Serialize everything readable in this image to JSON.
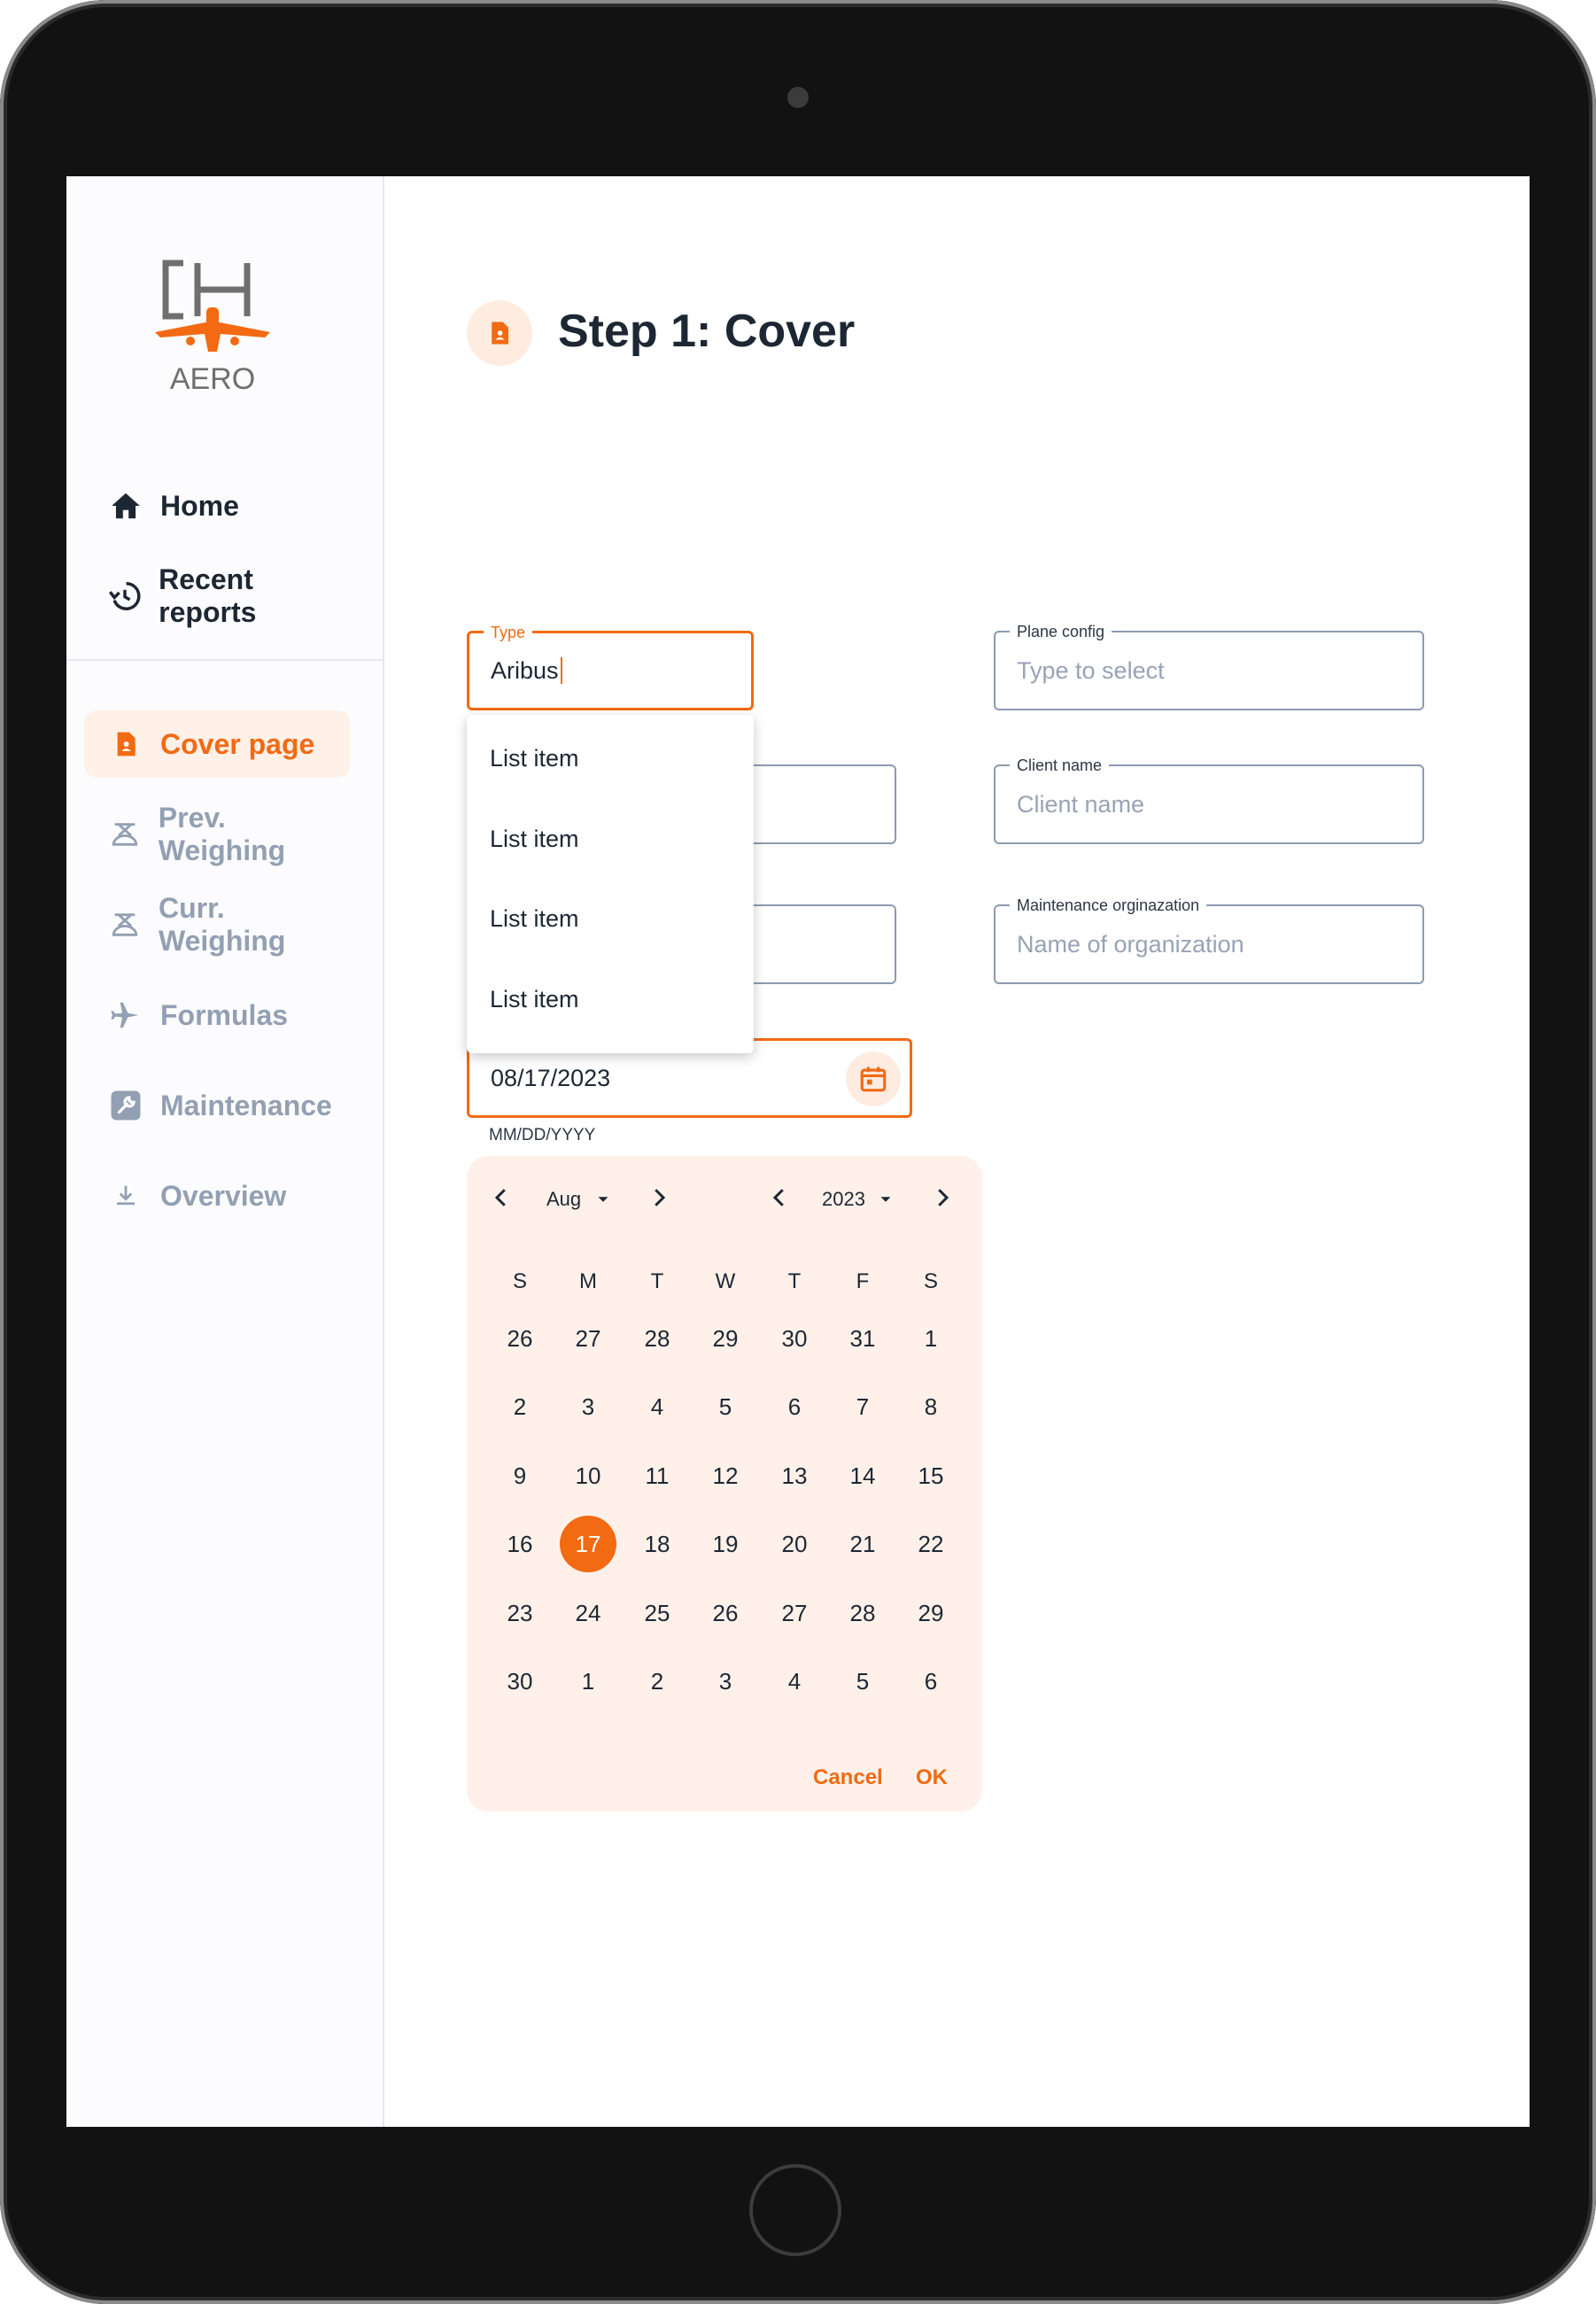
{
  "app": {
    "logo_text": "AERO"
  },
  "sidebar": {
    "primary": [
      {
        "label": "Home",
        "icon": "home-icon"
      },
      {
        "label": "Recent reports",
        "icon": "history-icon"
      }
    ],
    "steps": [
      {
        "label": "Cover page",
        "icon": "document-icon",
        "active": true
      },
      {
        "label": "Prev. Weighing",
        "icon": "scale-icon"
      },
      {
        "label": "Curr. Weighing",
        "icon": "scale-icon"
      },
      {
        "label": "Formulas",
        "icon": "airplane-icon"
      },
      {
        "label": "Maintenance",
        "icon": "wrench-icon"
      },
      {
        "label": "Overview",
        "icon": "download-icon"
      }
    ]
  },
  "page": {
    "title": "Step 1: Cover"
  },
  "form": {
    "type": {
      "label": "Type",
      "value": "Aribus"
    },
    "plane_config": {
      "label": "Plane config",
      "placeholder": "Type to select"
    },
    "client_name": {
      "label": "Client name",
      "placeholder": "Client name"
    },
    "maintenance_org": {
      "label": "Maintenance orginazation",
      "placeholder": "Name of organization"
    },
    "date": {
      "value": "08/17/2023",
      "hint": "MM/DD/YYYY"
    }
  },
  "dropdown": {
    "items": [
      "List item",
      "List item",
      "List item",
      "List item"
    ]
  },
  "datepicker": {
    "month": "Aug",
    "year": "2023",
    "weekdays": [
      "S",
      "M",
      "T",
      "W",
      "T",
      "F",
      "S"
    ],
    "weeks": [
      [
        "26",
        "27",
        "28",
        "29",
        "30",
        "31",
        "1"
      ],
      [
        "2",
        "3",
        "4",
        "5",
        "6",
        "7",
        "8"
      ],
      [
        "9",
        "10",
        "11",
        "12",
        "13",
        "14",
        "15"
      ],
      [
        "16",
        "17",
        "18",
        "19",
        "20",
        "21",
        "22"
      ],
      [
        "23",
        "24",
        "25",
        "26",
        "27",
        "28",
        "29"
      ],
      [
        "30",
        "1",
        "2",
        "3",
        "4",
        "5",
        "6"
      ]
    ],
    "selected": "17",
    "cancel_label": "Cancel",
    "ok_label": "OK"
  },
  "colors": {
    "accent": "#f26a12",
    "accent_soft": "#fff1e8",
    "text": "#1d2733",
    "muted": "#93a0b3"
  }
}
